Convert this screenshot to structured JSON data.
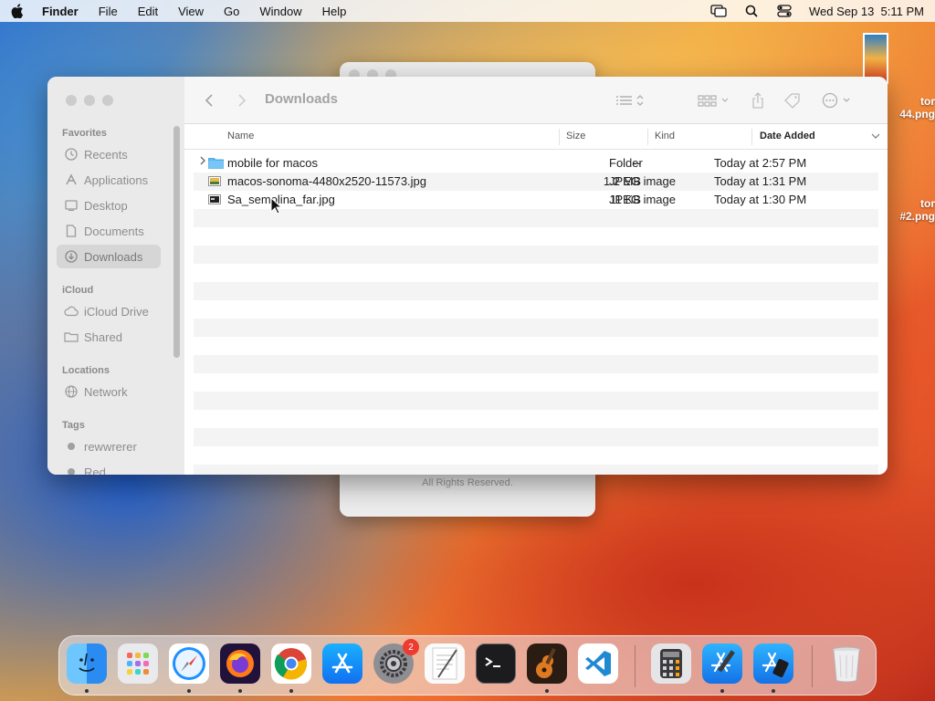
{
  "menubar": {
    "app_name": "Finder",
    "items": [
      "File",
      "Edit",
      "View",
      "Go",
      "Window",
      "Help"
    ],
    "clock": "Wed Sep 13  5:11 PM"
  },
  "desktop": {
    "files": [
      {
        "line1": "tor",
        "line2": "44.png"
      },
      {
        "line1": "tor",
        "line2": "#2.png"
      }
    ]
  },
  "background_window": {
    "footer": "All Rights Reserved."
  },
  "finder": {
    "title": "Downloads",
    "sidebar": {
      "favorites_label": "Favorites",
      "favorites": [
        {
          "label": "Recents",
          "icon": "clock-icon"
        },
        {
          "label": "Applications",
          "icon": "applications-icon"
        },
        {
          "label": "Desktop",
          "icon": "desktop-icon"
        },
        {
          "label": "Documents",
          "icon": "document-icon"
        },
        {
          "label": "Downloads",
          "icon": "download-icon",
          "selected": true
        }
      ],
      "icloud_label": "iCloud",
      "icloud": [
        {
          "label": "iCloud Drive",
          "icon": "cloud-icon"
        },
        {
          "label": "Shared",
          "icon": "shared-folder-icon"
        }
      ],
      "locations_label": "Locations",
      "locations": [
        {
          "label": "Network",
          "icon": "globe-icon"
        }
      ],
      "tags_label": "Tags",
      "tags": [
        {
          "label": "rewwrerer",
          "color": "#a0a0a0"
        },
        {
          "label": "Red",
          "color": "#a0a0a0"
        }
      ]
    },
    "columns": {
      "name": "Name",
      "size": "Size",
      "kind": "Kind",
      "date_added": "Date Added"
    },
    "files": [
      {
        "name": "mobile for macos",
        "size": "--",
        "kind": "Folder",
        "date": "Today at 2:57 PM",
        "type": "folder"
      },
      {
        "name": "macos-sonoma-4480x2520-11573.jpg",
        "size": "1.2 MB",
        "kind": "JPEG image",
        "date": "Today at 1:31 PM",
        "type": "image"
      },
      {
        "name": "Sa_semolina_far.jpg",
        "size": "11 KB",
        "kind": "JPEG image",
        "date": "Today at 1:30 PM",
        "type": "image"
      }
    ]
  },
  "dock": {
    "apps": [
      {
        "name": "Finder",
        "icon": "finder-icon",
        "running": true
      },
      {
        "name": "Launchpad",
        "icon": "launchpad-icon",
        "running": false
      },
      {
        "name": "Safari",
        "icon": "safari-icon",
        "running": true
      },
      {
        "name": "Firefox",
        "icon": "firefox-icon",
        "running": true
      },
      {
        "name": "Chrome",
        "icon": "chrome-icon",
        "running": true
      },
      {
        "name": "App Store",
        "icon": "app-store-icon",
        "running": false
      },
      {
        "name": "System Settings",
        "icon": "settings-icon",
        "running": false,
        "badge": "2"
      },
      {
        "name": "TextEdit",
        "icon": "textedit-icon",
        "running": false
      },
      {
        "name": "Terminal",
        "icon": "terminal-icon",
        "running": false
      },
      {
        "name": "GarageBand",
        "icon": "garageband-icon",
        "running": true
      },
      {
        "name": "VS Code",
        "icon": "vscode-icon",
        "running": false
      },
      {
        "name": "Calculator",
        "icon": "calculator-icon",
        "running": false
      },
      {
        "name": "Xcode",
        "icon": "xcode-icon",
        "running": true
      },
      {
        "name": "Simulator",
        "icon": "simulator-icon",
        "running": true
      },
      {
        "name": "Trash",
        "icon": "trash-icon",
        "running": false
      }
    ]
  }
}
